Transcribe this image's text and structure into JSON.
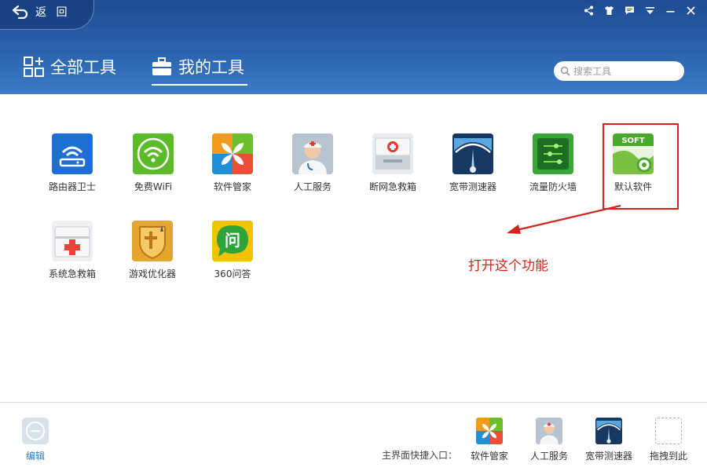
{
  "header": {
    "back_label": "返 回",
    "tabs": [
      {
        "label": "全部工具",
        "icon": "grid-plus-icon",
        "active": false
      },
      {
        "label": "我的工具",
        "icon": "toolbox-icon",
        "active": true
      }
    ],
    "search_placeholder": "搜索工具",
    "window_controls": [
      "share-icon",
      "skin-icon",
      "feedback-icon",
      "menu-icon",
      "minimize-icon",
      "close-icon"
    ]
  },
  "tools": [
    {
      "label": "路由器卫士",
      "icon": "router-guard-icon"
    },
    {
      "label": "免费WiFi",
      "icon": "wifi-icon"
    },
    {
      "label": "软件管家",
      "icon": "software-manager-icon"
    },
    {
      "label": "人工服务",
      "icon": "doctor-service-icon"
    },
    {
      "label": "断网急救箱",
      "icon": "network-firstaid-icon"
    },
    {
      "label": "宽带测速器",
      "icon": "speedometer-icon"
    },
    {
      "label": "流量防火墙",
      "icon": "traffic-firewall-icon"
    },
    {
      "label": "默认软件",
      "icon": "default-software-icon",
      "highlighted": true
    },
    {
      "label": "系统急救箱",
      "icon": "system-firstaid-icon"
    },
    {
      "label": "游戏优化器",
      "icon": "game-optimizer-icon"
    },
    {
      "label": "360问答",
      "icon": "qa-icon"
    }
  ],
  "annotation": {
    "text": "打开这个功能",
    "color": "#d0261f"
  },
  "bottom": {
    "edit_label": "编辑",
    "shortcut_label": "主界面快捷入口：",
    "shortcuts": [
      {
        "label": "软件管家",
        "icon": "software-manager-icon"
      },
      {
        "label": "人工服务",
        "icon": "doctor-service-icon"
      },
      {
        "label": "宽带测速器",
        "icon": "speedometer-icon"
      },
      {
        "label": "拖拽到此",
        "icon": "drop-slot-icon"
      }
    ]
  },
  "colors": {
    "header": "#2a63ad",
    "accent": "#2f7ab8",
    "annotation": "#d0261f"
  }
}
